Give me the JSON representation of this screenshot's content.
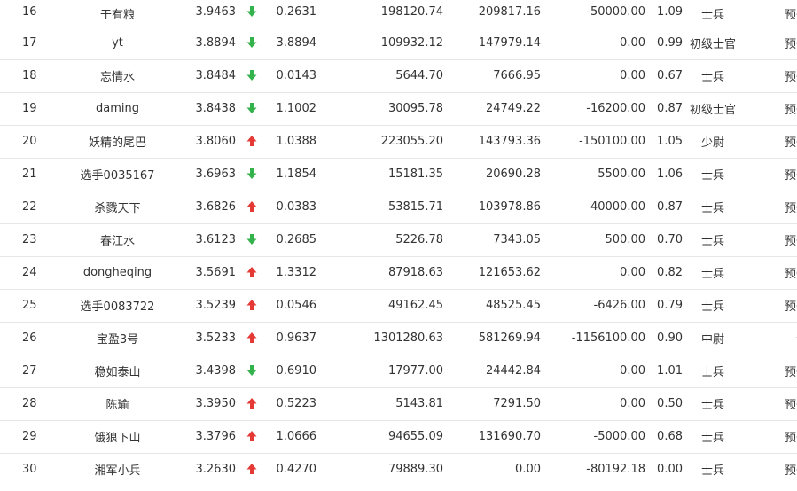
{
  "colors": {
    "up": "#e53935",
    "down": "#34b24c"
  },
  "rows": [
    {
      "rank": "16",
      "name": "于有粮",
      "score": "3.9463",
      "trend": "down",
      "ratio": "0.2631",
      "v1": "198120.74",
      "v2": "209817.16",
      "v3": "-50000.00",
      "v4": "1.09",
      "title": "士兵",
      "type": "预备役"
    },
    {
      "rank": "17",
      "name": "yt",
      "score": "3.8894",
      "trend": "down",
      "ratio": "3.8894",
      "v1": "109932.12",
      "v2": "147979.14",
      "v3": "0.00",
      "v4": "0.99",
      "title": "初级士官",
      "type": "预备役"
    },
    {
      "rank": "18",
      "name": "忘情水",
      "score": "3.8484",
      "trend": "down",
      "ratio": "0.0143",
      "v1": "5644.70",
      "v2": "7666.95",
      "v3": "0.00",
      "v4": "0.67",
      "title": "士兵",
      "type": "预备役"
    },
    {
      "rank": "19",
      "name": "daming",
      "score": "3.8438",
      "trend": "down",
      "ratio": "1.1002",
      "v1": "30095.78",
      "v2": "24749.22",
      "v3": "-16200.00",
      "v4": "0.87",
      "title": "初级士官",
      "type": "预备役"
    },
    {
      "rank": "20",
      "name": "妖精的尾巴",
      "score": "3.8060",
      "trend": "up",
      "ratio": "1.0388",
      "v1": "223055.20",
      "v2": "143793.36",
      "v3": "-150100.00",
      "v4": "1.05",
      "title": "少尉",
      "type": "预备役"
    },
    {
      "rank": "21",
      "name": "选手0035167",
      "score": "3.6963",
      "trend": "down",
      "ratio": "1.1854",
      "v1": "15181.35",
      "v2": "20690.28",
      "v3": "5500.00",
      "v4": "1.06",
      "title": "士兵",
      "type": "预备役"
    },
    {
      "rank": "22",
      "name": "杀戮天下",
      "score": "3.6826",
      "trend": "up",
      "ratio": "0.0383",
      "v1": "53815.71",
      "v2": "103978.86",
      "v3": "40000.00",
      "v4": "0.87",
      "title": "士兵",
      "type": "预备役"
    },
    {
      "rank": "23",
      "name": "春江水",
      "score": "3.6123",
      "trend": "down",
      "ratio": "0.2685",
      "v1": "5226.78",
      "v2": "7343.05",
      "v3": "500.00",
      "v4": "0.70",
      "title": "士兵",
      "type": "预备役"
    },
    {
      "rank": "24",
      "name": "dongheqing",
      "score": "3.5691",
      "trend": "up",
      "ratio": "1.3312",
      "v1": "87918.63",
      "v2": "121653.62",
      "v3": "0.00",
      "v4": "0.82",
      "title": "士兵",
      "type": "预备役"
    },
    {
      "rank": "25",
      "name": "选手0083722",
      "score": "3.5239",
      "trend": "up",
      "ratio": "0.0546",
      "v1": "49162.45",
      "v2": "48525.45",
      "v3": "-6426.00",
      "v4": "0.79",
      "title": "士兵",
      "type": "预备役"
    },
    {
      "rank": "26",
      "name": "宝盈3号",
      "score": "3.5233",
      "trend": "up",
      "ratio": "0.9637",
      "v1": "1301280.63",
      "v2": "581269.94",
      "v3": "-1156100.00",
      "v4": "0.90",
      "title": "中尉",
      "type": "海军"
    },
    {
      "rank": "27",
      "name": "稳如泰山",
      "score": "3.4398",
      "trend": "down",
      "ratio": "0.6910",
      "v1": "17977.00",
      "v2": "24442.84",
      "v3": "0.00",
      "v4": "1.01",
      "title": "士兵",
      "type": "预备役"
    },
    {
      "rank": "28",
      "name": "陈瑜",
      "score": "3.3950",
      "trend": "up",
      "ratio": "0.5223",
      "v1": "5143.81",
      "v2": "7291.50",
      "v3": "0.00",
      "v4": "0.50",
      "title": "士兵",
      "type": "预备役"
    },
    {
      "rank": "29",
      "name": "饿狼下山",
      "score": "3.3796",
      "trend": "up",
      "ratio": "1.0666",
      "v1": "94655.09",
      "v2": "131690.70",
      "v3": "-5000.00",
      "v4": "0.68",
      "title": "士兵",
      "type": "预备役"
    },
    {
      "rank": "30",
      "name": "湘军小兵",
      "score": "3.2630",
      "trend": "up",
      "ratio": "0.4270",
      "v1": "79889.30",
      "v2": "0.00",
      "v3": "-80192.18",
      "v4": "0.00",
      "title": "士兵",
      "type": "预备役"
    }
  ]
}
